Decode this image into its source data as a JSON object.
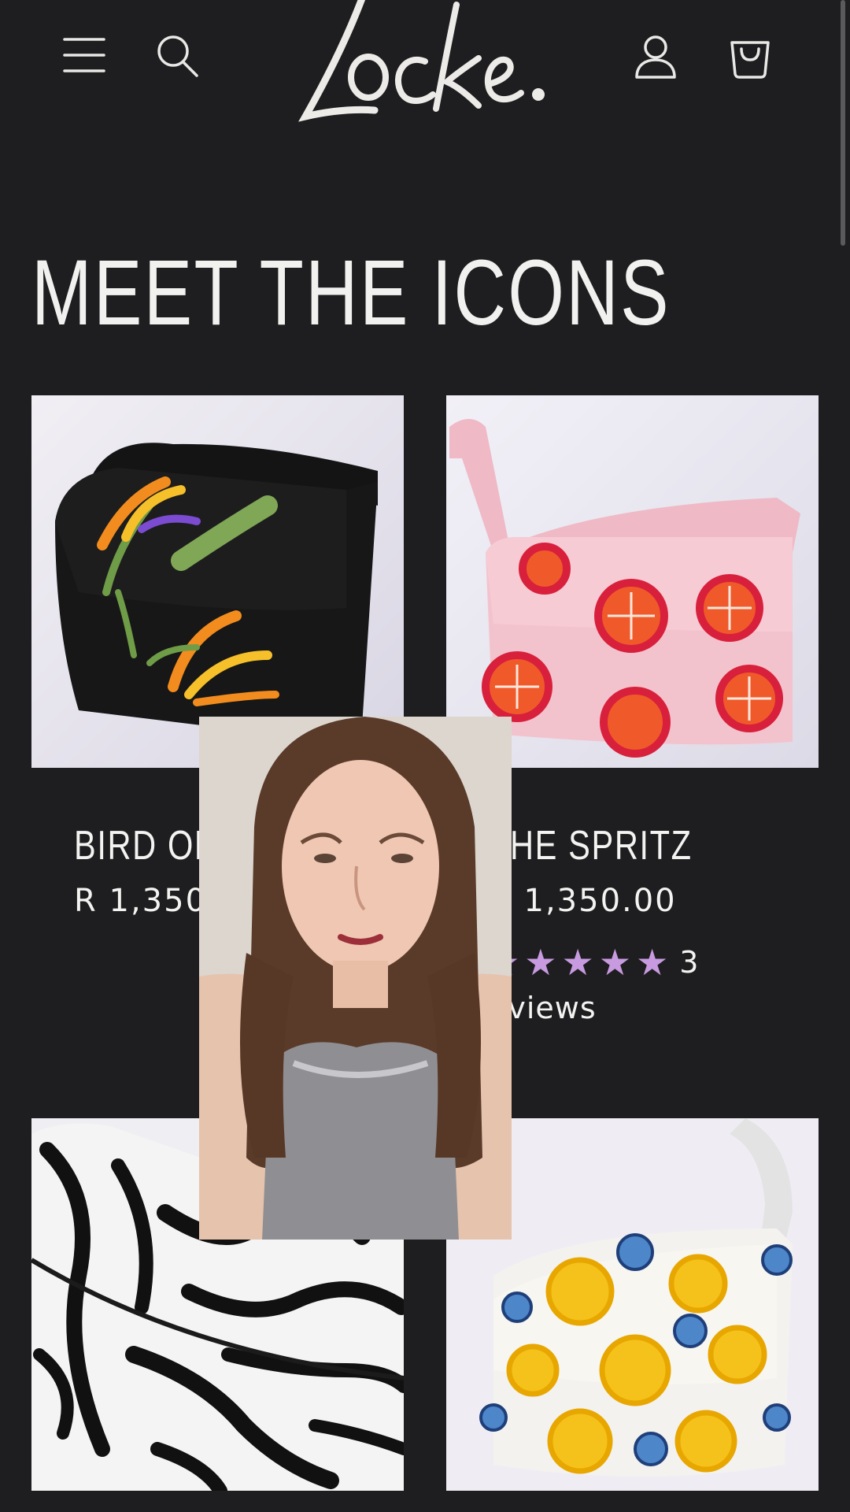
{
  "header": {
    "logo_text": "Locke.",
    "menu_icon": "hamburger-menu-icon",
    "search_icon": "search-icon",
    "account_icon": "user-account-icon",
    "cart_icon": "shopping-bag-icon"
  },
  "section": {
    "heading": "MEET THE ICONS"
  },
  "products": [
    {
      "title": "BIRD OF PARA",
      "price": "R 1,350.00",
      "image": "black beaded bag with bird of paradise flowers"
    },
    {
      "title": "THE SPRITZ",
      "price": "R 1,350.00",
      "rating_stars": 5,
      "rating_count": "3",
      "reviews_label": "eviews",
      "image": "pink beaded bag with orange slices"
    },
    {
      "image": "black and white zebra beaded bag"
    },
    {
      "image": "white beaded bag with lemons and blueberries"
    }
  ],
  "overlay": {
    "description": "video presenter overlay"
  },
  "colors": {
    "background": "#1e1e20",
    "text": "#f3f3f1",
    "star": "#c89be0"
  }
}
